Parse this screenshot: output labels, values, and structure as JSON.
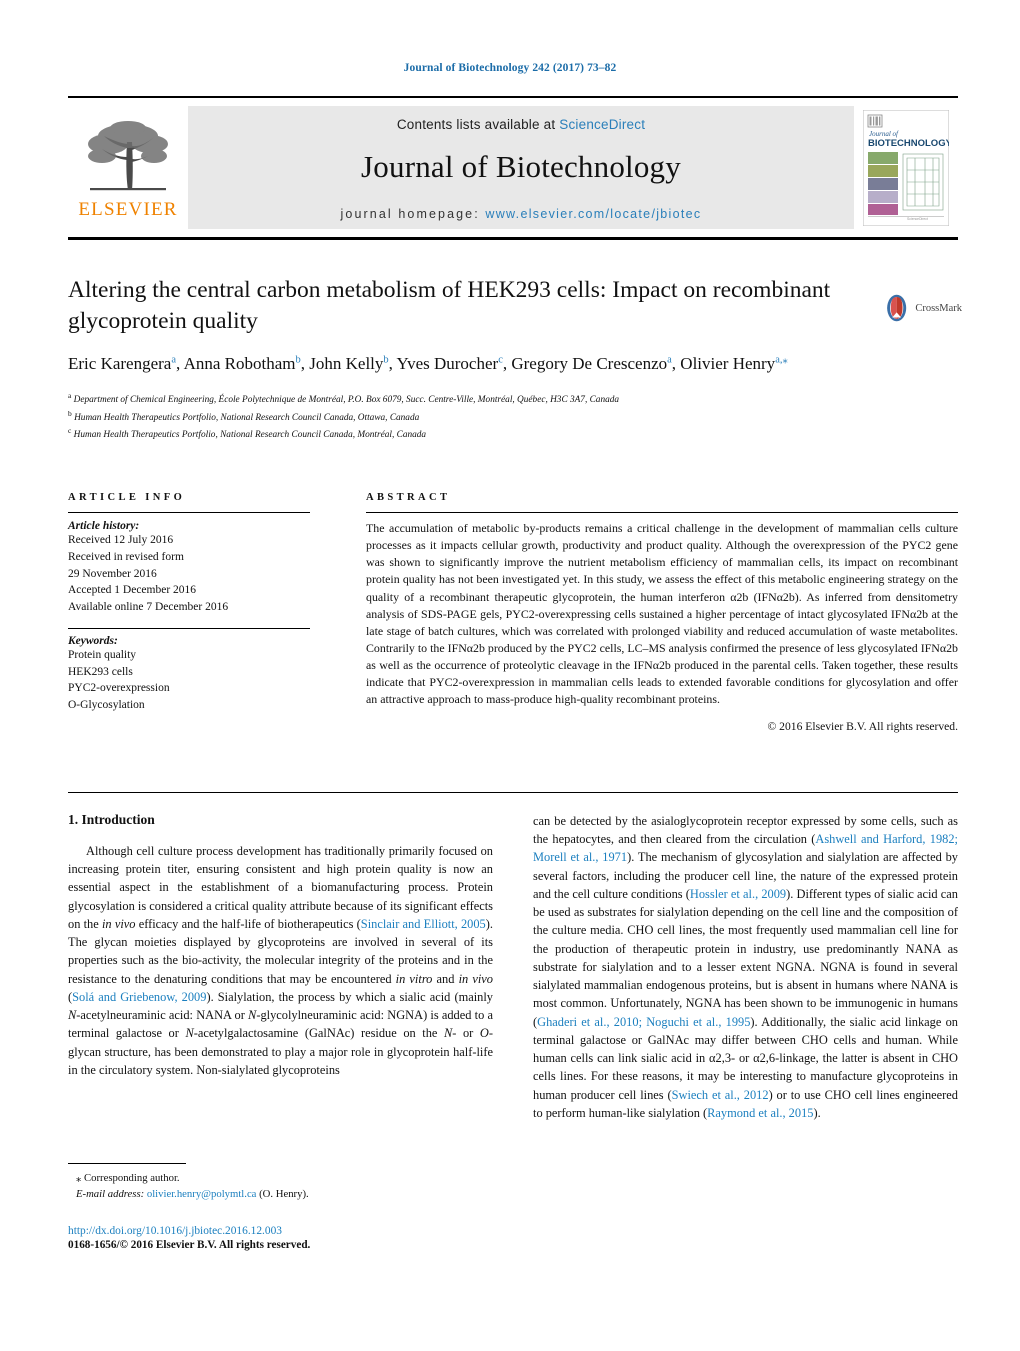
{
  "running_head": "Journal of Biotechnology 242 (2017) 73–82",
  "masthead": {
    "publisher_logo_text": "ELSEVIER",
    "contents_prefix": "Contents lists available at ",
    "contents_link": "ScienceDirect",
    "journal_name": "Journal of Biotechnology",
    "homepage_prefix": "journal homepage: ",
    "homepage_url": "www.elsevier.com/locate/jbiotec",
    "cover": {
      "line1": "Journal of",
      "line2": "BIOTECHNOLOGY"
    }
  },
  "article": {
    "title": "Altering the central carbon metabolism of HEK293 cells: Impact on recombinant glycoprotein quality",
    "authors_html": "Eric Karengera<sup>a</sup>, Anna Robotham<sup>b</sup>, John Kelly<sup>b</sup>, Yves Durocher<sup>c</sup>, Gregory De Crescenzo<sup>a</sup>, Olivier Henry<sup>a,⁎</sup>",
    "affiliations": [
      "a Department of Chemical Engineering, École Polytechnique de Montréal, P.O. Box 6079, Succ. Centre-Ville, Montréal, Québec, H3C 3A7, Canada",
      "b Human Health Therapeutics Portfolio, National Research Council Canada, Ottawa, Canada",
      "c Human Health Therapeutics Portfolio, National Research Council Canada, Montréal, Canada"
    ],
    "crossmark_label": "CrossMark"
  },
  "article_info": {
    "heading": "ARTICLE INFO",
    "history_label": "Article history:",
    "history": [
      "Received 12 July 2016",
      "Received in revised form",
      "29 November 2016",
      "Accepted 1 December 2016",
      "Available online 7 December 2016"
    ],
    "keywords_label": "Keywords:",
    "keywords": [
      "Protein quality",
      "HEK293 cells",
      "PYC2-overexpression",
      "O-Glycosylation"
    ]
  },
  "abstract": {
    "heading": "ABSTRACT",
    "text": "The accumulation of metabolic by-products remains a critical challenge in the development of mammalian cells culture processes as it impacts cellular growth, productivity and product quality. Although the overexpression of the PYC2 gene was shown to significantly improve the nutrient metabolism efficiency of mammalian cells, its impact on recombinant protein quality has not been investigated yet. In this study, we assess the effect of this metabolic engineering strategy on the quality of a recombinant therapeutic glycoprotein, the human interferon α2b (IFNα2b). As inferred from densitometry analysis of SDS-PAGE gels, PYC2-overexpressing cells sustained a higher percentage of intact glycosylated IFNα2b at the late stage of batch cultures, which was correlated with prolonged viability and reduced accumulation of waste metabolites. Contrarily to the IFNα2b produced by the PYC2 cells, LC–MS analysis confirmed the presence of less glycosylated IFNα2b as well as the occurrence of proteolytic cleavage in the IFNα2b produced in the parental cells. Taken together, these results indicate that PYC2-overexpression in mammalian cells leads to extended favorable conditions for glycosylation and offer an attractive approach to mass-produce high-quality recombinant proteins.",
    "copyright": "© 2016 Elsevier B.V. All rights reserved."
  },
  "body": {
    "section_heading": "1. Introduction",
    "left_paragraph_html": "Although cell culture process development has traditionally primarily focused on increasing protein titer, ensuring consistent and high protein quality is now an essential aspect in the establishment of a biomanufacturing process. Protein glycosylation is considered a critical quality attribute because of its significant effects on the <em>in vivo</em> efficacy and the half-life of biotherapeutics (<span class=\"ref\">Sinclair and Elliott, 2005</span>). The glycan moieties displayed by glycoproteins are involved in several of its properties such as the bio-activity, the molecular integrity of the proteins and in the resistance to the denaturing conditions that may be encountered <em>in vitro</em> and <em>in vivo</em> (<span class=\"ref\">Solá and Griebenow, 2009</span>). Sialylation, the process by which a sialic acid (mainly <em>N</em>-acetylneuraminic acid: NANA or <em>N</em>-glycolylneuraminic acid: NGNA) is added to a terminal galactose or <em>N</em>-acetylgalactosamine (GalNAc) residue on the <em>N</em>- or <em>O</em>- glycan structure, has been demonstrated to play a major role in glycoprotein half-life in the circulatory system. Non-sialylated glycoproteins",
    "right_paragraph_html": "can be detected by the asialoglycoprotein receptor expressed by some cells, such as the hepatocytes, and then cleared from the circulation (<span class=\"ref\">Ashwell and Harford, 1982; Morell et al., 1971</span>). The mechanism of glycosylation and sialylation are affected by several factors, including the producer cell line, the nature of the expressed protein and the cell culture conditions (<span class=\"ref\">Hossler et al., 2009</span>). Different types of sialic acid can be used as substrates for sialylation depending on the cell line and the composition of the culture media. CHO cell lines, the most frequently used mammalian cell line for the production of therapeutic protein in industry, use predominantly NANA as substrate for sialylation and to a lesser extent NGNA. NGNA is found in several sialylated mammalian endogenous proteins, but is absent in humans where NANA is most common. Unfortunately, NGNA has been shown to be immunogenic in humans (<span class=\"ref\">Ghaderi et al., 2010; Noguchi et al., 1995</span>). Additionally, the sialic acid linkage on terminal galactose or GalNAc may differ between CHO cells and human. While human cells can link sialic acid in α2,3- or α2,6-linkage, the latter is absent in CHO cells lines. For these reasons, it may be interesting to manufacture glycoproteins in human producer cell lines (<span class=\"ref\">Swiech et al., 2012</span>) or to use CHO cell lines engineered to perform human-like sialylation (<span class=\"ref\">Raymond et al., 2015</span>)."
  },
  "footer": {
    "corresponding_marker": "⁎",
    "corresponding_text": "Corresponding author.",
    "email_label": "E-mail address:",
    "email": "olivier.henry@polymtl.ca",
    "email_owner": "(O. Henry).",
    "doi_url": "http://dx.doi.org/10.1016/j.jbiotec.2016.12.003",
    "issn_line": "0168-1656/© 2016 Elsevier B.V. All rights reserved."
  },
  "colors": {
    "link": "#1b7fbf",
    "sciencedirect": "#2a7fba",
    "elsevier_orange": "#ef8200",
    "running_head": "#1b6ca8"
  }
}
